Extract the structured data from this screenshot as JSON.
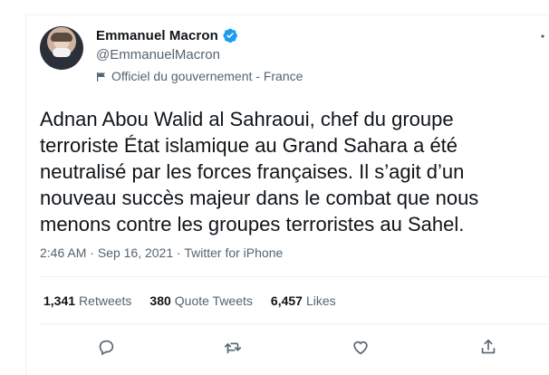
{
  "author": {
    "name": "Emmanuel Macron",
    "handle": "@EmmanuelMacron",
    "affiliation": "Officiel du gouvernement - France",
    "verified": true
  },
  "tweet": {
    "text": "Adnan Abou Walid al Sahraoui, chef du groupe terroriste État islamique au Grand Sahara a été neutralisé par les forces françaises. Il s’agit d’un nouveau succès majeur dans le combat que nous menons contre les groupes terroristes au Sahel.",
    "time": "2:46 AM",
    "date": "Sep 16, 2021",
    "source": "Twitter for iPhone"
  },
  "stats": {
    "retweets_count": "1,341",
    "retweets_label": "Retweets",
    "quotes_count": "380",
    "quotes_label": "Quote Tweets",
    "likes_count": "6,457",
    "likes_label": "Likes"
  },
  "icons": {
    "reply": "reply-icon",
    "retweet": "retweet-icon",
    "like": "like-icon",
    "share": "share-icon",
    "verified": "verified-badge-icon",
    "flag": "flag-icon",
    "more": "more-options-icon"
  },
  "colors": {
    "verified_blue": "#1d9bf0",
    "secondary_text": "#536471",
    "primary_text": "#0f1419"
  }
}
